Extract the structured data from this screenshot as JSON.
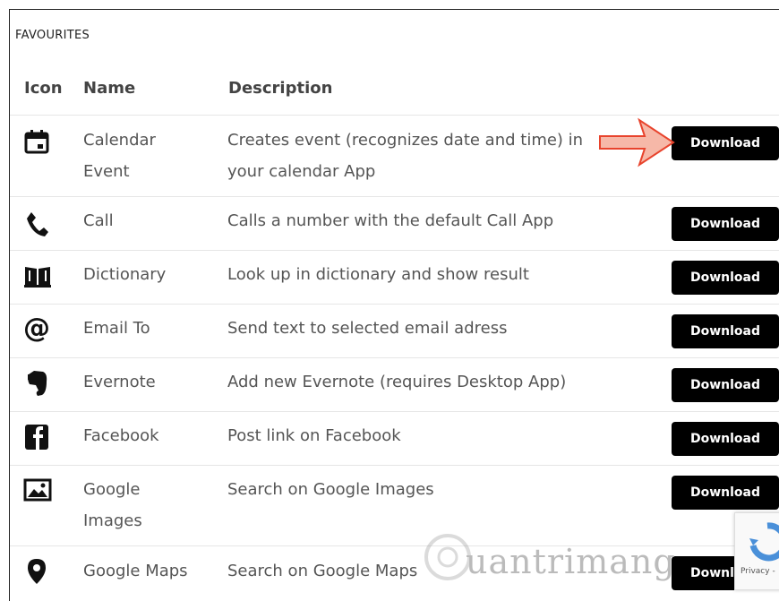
{
  "section_title": "FAVOURITES",
  "table": {
    "headers": {
      "icon": "Icon",
      "name": "Name",
      "description": "Description"
    },
    "download_label": "Download",
    "rows": [
      {
        "icon": "calendar-icon",
        "name_line1": "Calendar",
        "name_line2": "Event",
        "desc_line1": "Creates event (recognizes date and time) in",
        "desc_line2": "your calendar App"
      },
      {
        "icon": "phone-icon",
        "name_line1": "Call",
        "name_line2": "",
        "desc_line1": "Calls a number with the default Call App",
        "desc_line2": ""
      },
      {
        "icon": "book-icon",
        "name_line1": "Dictionary",
        "name_line2": "",
        "desc_line1": "Look up in dictionary and show result",
        "desc_line2": ""
      },
      {
        "icon": "at-sign-icon",
        "name_line1": "Email To",
        "name_line2": "",
        "desc_line1": "Send text to selected email adress",
        "desc_line2": ""
      },
      {
        "icon": "evernote-icon",
        "name_line1": "Evernote",
        "name_line2": "",
        "desc_line1": "Add new Evernote (requires Desktop App)",
        "desc_line2": ""
      },
      {
        "icon": "facebook-icon",
        "name_line1": "Facebook",
        "name_line2": "",
        "desc_line1": "Post link on Facebook",
        "desc_line2": ""
      },
      {
        "icon": "image-icon",
        "name_line1": "Google",
        "name_line2": "Images",
        "desc_line1": "Search on Google Images",
        "desc_line2": ""
      },
      {
        "icon": "map-pin-icon",
        "name_line1": "Google Maps",
        "name_line2": "",
        "desc_line1": "Search on Google Maps",
        "desc_line2": ""
      }
    ]
  },
  "annotation": {
    "arrow_color": "#e8432c"
  },
  "watermark": {
    "text": "uantrimang"
  },
  "recaptcha": {
    "label": "Privacy -"
  }
}
